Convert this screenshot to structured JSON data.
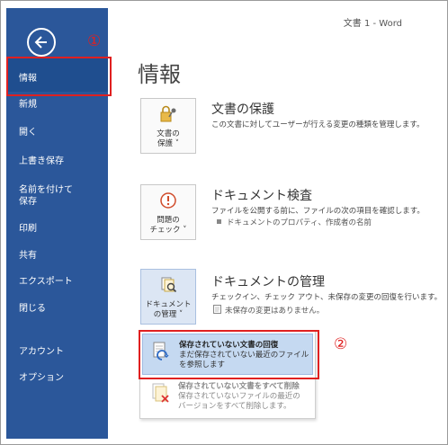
{
  "window_title": "文書 1 - Word",
  "page_title": "情報",
  "annotations": {
    "marker_1": "①",
    "marker_2": "②"
  },
  "sidebar": {
    "items": [
      {
        "label": "情報"
      },
      {
        "label": "新規"
      },
      {
        "label": "開く"
      },
      {
        "label": "上書き保存"
      },
      {
        "label": "名前を付けて\n保存"
      },
      {
        "label": "印刷"
      },
      {
        "label": "共有"
      },
      {
        "label": "エクスポート"
      },
      {
        "label": "閉じる"
      },
      {
        "label": "アカウント"
      },
      {
        "label": "オプション"
      }
    ]
  },
  "sections": {
    "protect": {
      "tile_label_1": "文書の",
      "tile_label_2": "保護 ˅",
      "title": "文書の保護",
      "desc": "この文書に対してユーザーが行える変更の種類を管理します。"
    },
    "inspect": {
      "tile_label_1": "問題の",
      "tile_label_2": "チェック ˅",
      "title": "ドキュメント検査",
      "desc": "ファイルを公開する前に、ファイルの次の項目を確認します。",
      "bullet": "ドキュメントのプロパティ、作成者の名前"
    },
    "manage": {
      "tile_label_1": "ドキュメント",
      "tile_label_2": "の管理 ˅",
      "title": "ドキュメントの管理",
      "desc": "チェックイン、チェック アウト、未保存の変更の回復を行います。",
      "bullet": "未保存の変更はありません。"
    }
  },
  "dropdown": {
    "items": [
      {
        "title": "保存されていない文書の回復",
        "desc_1": "まだ保存されていない最近のファイル",
        "desc_2": "を参照します"
      },
      {
        "title": "保存されていない文書をすべて削除",
        "desc_1": "保存されていないファイルの最近の",
        "desc_2": "バージョンをすべて削除します。"
      }
    ]
  },
  "colors": {
    "sidebar": "#2b579a",
    "active_item": "#1f4e8f",
    "highlight": "#c5d9f1",
    "annotation_red": "#e02020"
  }
}
